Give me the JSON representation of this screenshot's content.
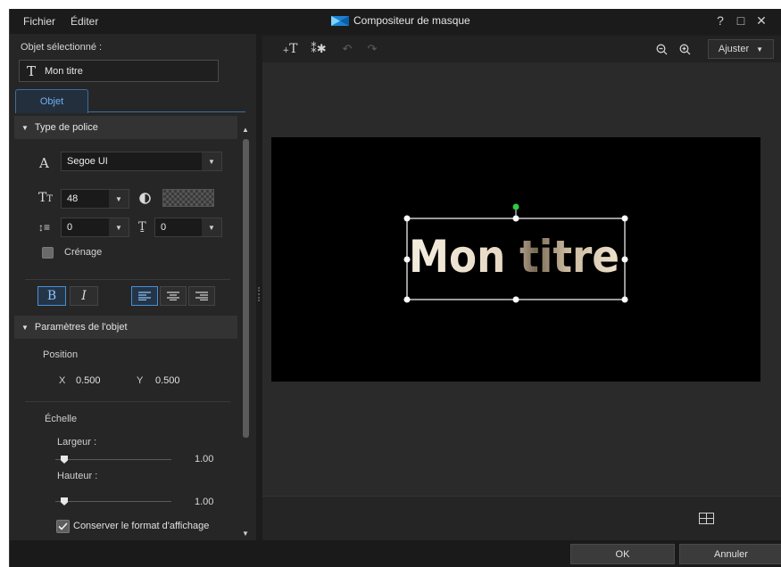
{
  "titlebar": {
    "menu": [
      "Fichier",
      "Éditer"
    ],
    "title": "Compositeur de masque",
    "help": "?",
    "maximize": "□",
    "close": "✕"
  },
  "left_panel": {
    "selected_label": "Objet sélectionné :",
    "selected_value": "Mon titre",
    "tab": "Objet",
    "font_section": {
      "header": "Type de police",
      "font_name": "Segoe UI",
      "font_size": "48",
      "line_spacing": "0",
      "char_spacing": "0",
      "kerning_label": "Crénage",
      "bold": "B",
      "italic": "I"
    },
    "object_section": {
      "header": "Paramètres de l'objet",
      "position_label": "Position",
      "x_label": "X",
      "x_value": "0.500",
      "y_label": "Y",
      "y_value": "0.500",
      "scale_label": "Échelle",
      "width_label": "Largeur :",
      "width_value": "1.00",
      "height_label": "Hauteur :",
      "height_value": "1.00",
      "keep_ratio_label": "Conserver le format d'affichage"
    }
  },
  "toolbar": {
    "ajuster_label": "Ajuster"
  },
  "canvas": {
    "text": "Mon titre"
  },
  "footer": {
    "ok": "OK",
    "cancel": "Annuler"
  }
}
